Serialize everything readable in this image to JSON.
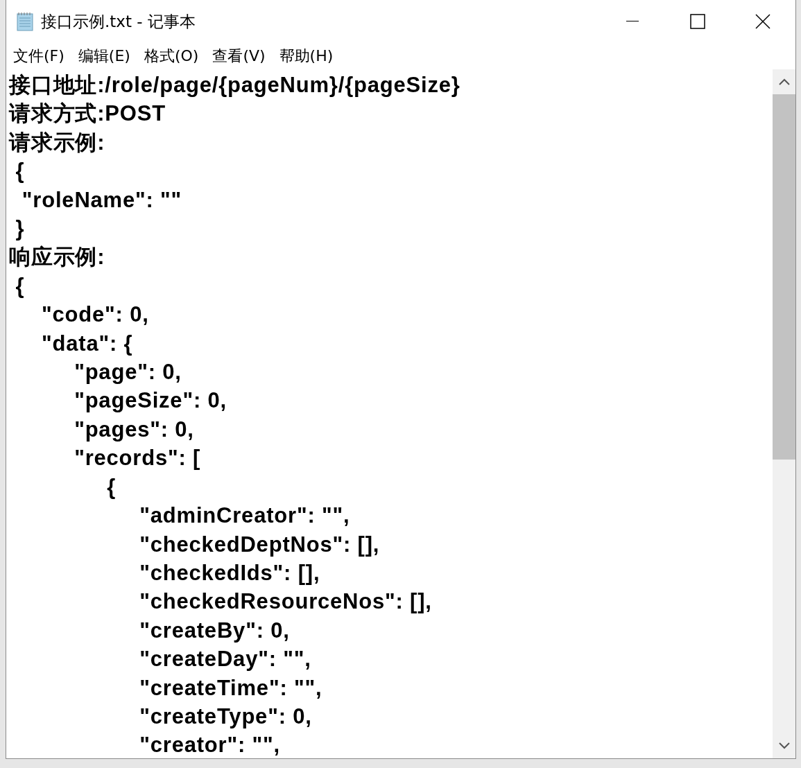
{
  "window": {
    "title": "接口示例.txt - 记事本"
  },
  "menu": [
    "文件(F)",
    "编辑(E)",
    "格式(O)",
    "查看(V)",
    "帮助(H)"
  ],
  "lines": [
    "接口地址:/role/page/{pageNum}/{pageSize}",
    "请求方式:POST",
    "请求示例:",
    " {",
    "  \"roleName\": \"\"",
    " }",
    "响应示例:",
    " {",
    "     \"code\": 0,",
    "     \"data\": {",
    "          \"page\": 0,",
    "          \"pageSize\": 0,",
    "          \"pages\": 0,",
    "          \"records\": [",
    "               {",
    "                    \"adminCreator\": \"\",",
    "                    \"checkedDeptNos\": [],",
    "                    \"checkedIds\": [],",
    "                    \"checkedResourceNos\": [],",
    "                    \"createBy\": 0,",
    "                    \"createDay\": \"\",",
    "                    \"createTime\": \"\",",
    "                    \"createType\": 0,",
    "                    \"creator\": \"\","
  ]
}
